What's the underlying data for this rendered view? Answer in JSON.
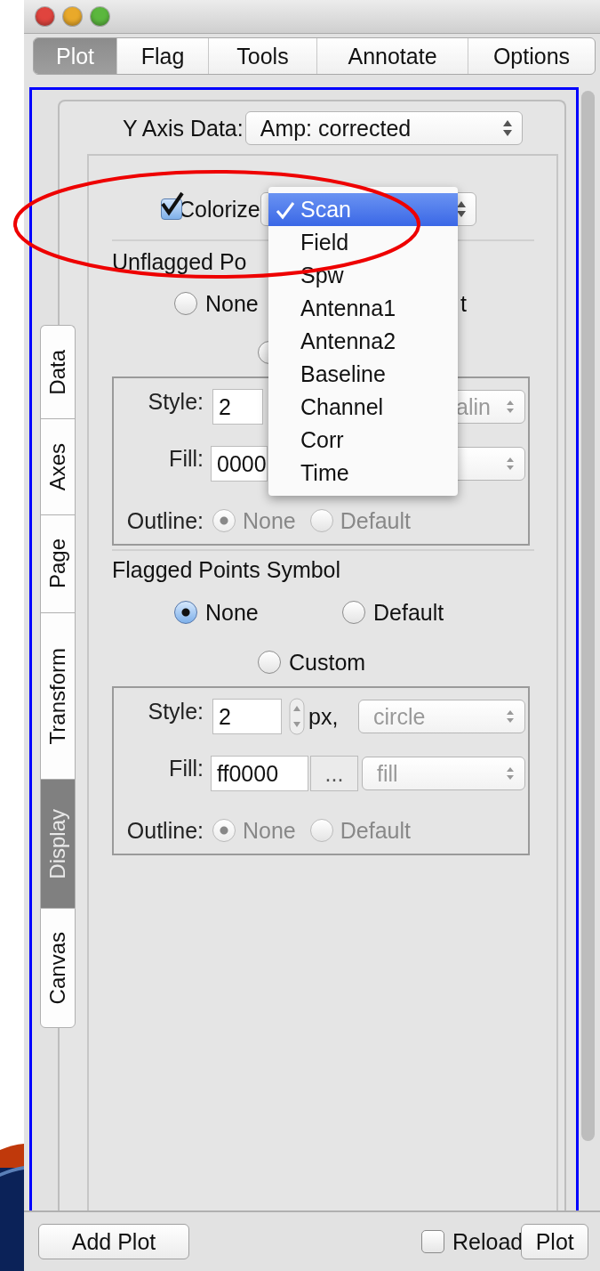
{
  "window": {
    "traffic_lights": [
      {
        "kind": "close"
      },
      {
        "kind": "minimize"
      },
      {
        "kind": "zoom"
      }
    ]
  },
  "tabs": [
    {
      "label": "Plot",
      "selected": true
    },
    {
      "label": "Flag",
      "selected": false
    },
    {
      "label": "Tools",
      "selected": false
    },
    {
      "label": "Annotate",
      "selected": false
    },
    {
      "label": "Options",
      "selected": false
    }
  ],
  "side_tabs": [
    {
      "label": "Data",
      "selected": false
    },
    {
      "label": "Axes",
      "selected": false
    },
    {
      "label": "Page",
      "selected": false
    },
    {
      "label": "Transform",
      "selected": false
    },
    {
      "label": "Display",
      "selected": true
    },
    {
      "label": "Canvas",
      "selected": false
    }
  ],
  "y_axis": {
    "label": "Y Axis Data:",
    "value": "Amp: corrected"
  },
  "colorize": {
    "label": "Colorize",
    "checked": true
  },
  "colorize_menu": [
    {
      "label": "Scan",
      "selected": true
    },
    {
      "label": "Field",
      "selected": false
    },
    {
      "label": "Spw",
      "selected": false
    },
    {
      "label": "Antenna1",
      "selected": false
    },
    {
      "label": "Antenna2",
      "selected": false
    },
    {
      "label": "Baseline",
      "selected": false
    },
    {
      "label": "Channel",
      "selected": false
    },
    {
      "label": "Corr",
      "selected": false
    },
    {
      "label": "Time",
      "selected": false
    }
  ],
  "unflagged": {
    "title": "Unflagged Po",
    "none_radio": {
      "label": "None",
      "selected": false
    },
    "default_fragment": "t",
    "custom_radio": {
      "selected": false
    },
    "symbol": {
      "style_label": "Style:",
      "size": "2",
      "shape_fragment": "alin",
      "fill_label": "Fill:",
      "fill": "0000",
      "outline_label": "Outline:",
      "outline": [
        {
          "label": "None",
          "selected": true
        },
        {
          "label": "Default",
          "selected": false
        }
      ]
    }
  },
  "flagged": {
    "title": "Flagged Points Symbol",
    "radios": [
      {
        "label": "None",
        "selected": true
      },
      {
        "label": "Default",
        "selected": false
      },
      {
        "label": "Custom",
        "selected": false
      }
    ],
    "symbol": {
      "style_label": "Style:",
      "size": "2",
      "unit": "px,",
      "shape": "circle",
      "fill_label": "Fill:",
      "fill": "ff0000",
      "picker": "...",
      "fill_mode": "fill",
      "outline_label": "Outline:",
      "outline": [
        {
          "label": "None",
          "selected": true
        },
        {
          "label": "Default",
          "selected": false
        }
      ]
    }
  },
  "footer": {
    "add_plot": "Add Plot",
    "reload": {
      "label": "Reload",
      "checked": false
    },
    "plot": "Plot"
  },
  "annotations": [
    {
      "kind": "ellipse"
    }
  ]
}
